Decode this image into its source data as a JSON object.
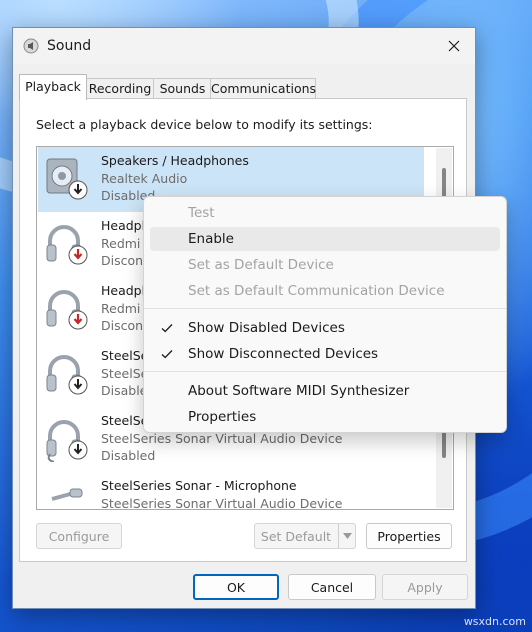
{
  "window": {
    "title": "Sound"
  },
  "tabs": [
    "Playback",
    "Recording",
    "Sounds",
    "Communications"
  ],
  "instruction": "Select a playback device below to modify its settings:",
  "devices": [
    {
      "name": "Speakers / Headphones",
      "sub": "Realtek Audio",
      "status": "Disabled",
      "icon": "speaker-icon"
    },
    {
      "name": "Headph",
      "sub": "Redmi",
      "status": "Disconn",
      "icon": "headphones-icon"
    },
    {
      "name": "Headph",
      "sub": "Redmi",
      "status": "Disconn",
      "icon": "headphones-icon"
    },
    {
      "name": "SteelSe",
      "sub": "SteelSe",
      "status": "Disable",
      "icon": "headset-icon"
    },
    {
      "name": "SteelSe",
      "sub": "SteelSeries Sonar Virtual Audio Device",
      "status": "Disabled",
      "icon": "headset-icon"
    },
    {
      "name": "SteelSeries Sonar - Microphone",
      "sub": "SteelSeries Sonar Virtual Audio Device",
      "status": "",
      "icon": "microphone-icon"
    }
  ],
  "buttons": {
    "configure": "Configure",
    "set_default": "Set Default",
    "properties": "Properties",
    "ok": "OK",
    "cancel": "Cancel",
    "apply": "Apply"
  },
  "context_menu": {
    "test": "Test",
    "enable": "Enable",
    "set_default": "Set as Default Device",
    "set_default_comm": "Set as Default Communication Device",
    "show_disabled": "Show Disabled Devices",
    "show_disconnected": "Show Disconnected Devices",
    "about_midi": "About Software MIDI Synthesizer",
    "properties": "Properties"
  },
  "watermark": "wsxdn.com"
}
